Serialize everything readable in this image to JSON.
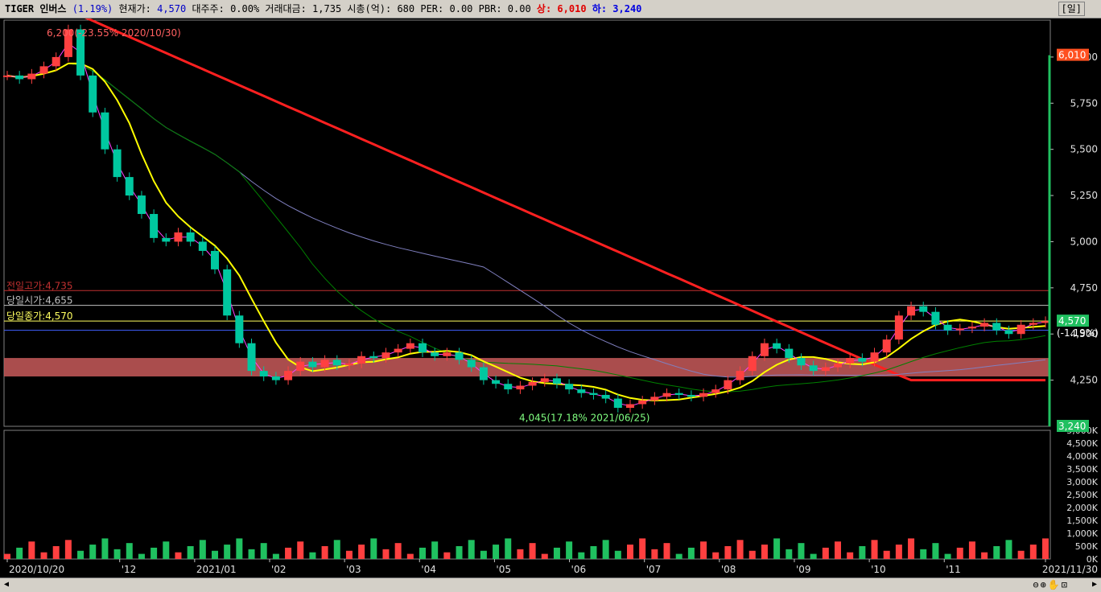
{
  "header": {
    "name": "TIGER 인버스",
    "change": "(1.19%)",
    "price_label": "현재가:",
    "price": "4,570",
    "major_label": "대주주:",
    "major": "0.00%",
    "amount_label": "거래대금:",
    "amount": "1,735",
    "cap_label": "시총(억):",
    "cap": "680",
    "per_label": "PER:",
    "per": "0.00",
    "pbr_label": "PBR:",
    "pbr": "0.00",
    "upper_label": "상:",
    "upper": "6,010",
    "lower_label": "하:",
    "lower": "3,240",
    "period": "[일]"
  },
  "chart_data": [
    {
      "type": "candlestick",
      "price_ticks": [
        4250,
        4500,
        4750,
        5000,
        5250,
        5500,
        5750,
        6000
      ],
      "price_tick_labels": [
        "4,250",
        "4,500",
        "4,750",
        "5,000",
        "5,250",
        "5,500",
        "5,750",
        "000"
      ],
      "ylim": [
        4000,
        6200
      ],
      "x_dates": [
        "2020/10/20",
        "'12",
        "2021/01",
        "'02",
        "'03",
        "'04",
        "'05",
        "'06",
        "'07",
        "'08",
        "'09",
        "'10",
        "'11",
        "2021/11/30"
      ],
      "x_date_positions": [
        0,
        30,
        50,
        70,
        90,
        110,
        130,
        150,
        170,
        190,
        210,
        230,
        250,
        277
      ],
      "close_path": [
        5900,
        5880,
        5910,
        5950,
        6000,
        6150,
        5900,
        5700,
        5500,
        5350,
        5250,
        5150,
        5020,
        5000,
        5050,
        5000,
        4950,
        4850,
        4600,
        4450,
        4300,
        4270,
        4250,
        4300,
        4350,
        4320,
        4360,
        4330,
        4340,
        4380,
        4370,
        4400,
        4420,
        4450,
        4400,
        4380,
        4400,
        4360,
        4320,
        4250,
        4230,
        4200,
        4220,
        4240,
        4260,
        4230,
        4200,
        4180,
        4170,
        4150,
        4100,
        4120,
        4140,
        4160,
        4180,
        4170,
        4160,
        4180,
        4200,
        4250,
        4300,
        4380,
        4450,
        4420,
        4370,
        4330,
        4300,
        4320,
        4340,
        4370,
        4350,
        4400,
        4470,
        4600,
        4650,
        4620,
        4550,
        4520,
        4530,
        4540,
        4560,
        4520,
        4500,
        4550,
        4560,
        4570
      ],
      "overlays": {
        "upper_limit": 6010,
        "lower_limit": 3240,
        "prev_high_label": "전일고가:4,735",
        "prev_high": 4735,
        "open_label": "당일시가:4,655",
        "open": 4655,
        "close_label": "당일종가:4,570",
        "close": 4570,
        "current_label": "4,570",
        "current_change": "(-1.19%)",
        "top_limit_label": "6,010",
        "bottom_limit_label": "3,240",
        "high_annotation": "6,200(-23.55% 2020/10/30)",
        "low_annotation": "4,045(17.18% 2021/06/25)"
      },
      "colors": {
        "up": "#ff4040",
        "down": "#00c8a0",
        "ma5": "#ff40ff",
        "ma20": "#ffff00",
        "ma60": "#008000",
        "ma120": "#8080c0",
        "ma240": "#ff2020"
      }
    },
    {
      "type": "volume",
      "ticks": [
        "5,000K",
        "4,500K",
        "4,000K",
        "3,500K",
        "3,000K",
        "2,500K",
        "2,000K",
        "1,500K",
        "1,000K",
        "500K",
        "0K"
      ],
      "ylim": [
        0,
        5000
      ]
    }
  ]
}
